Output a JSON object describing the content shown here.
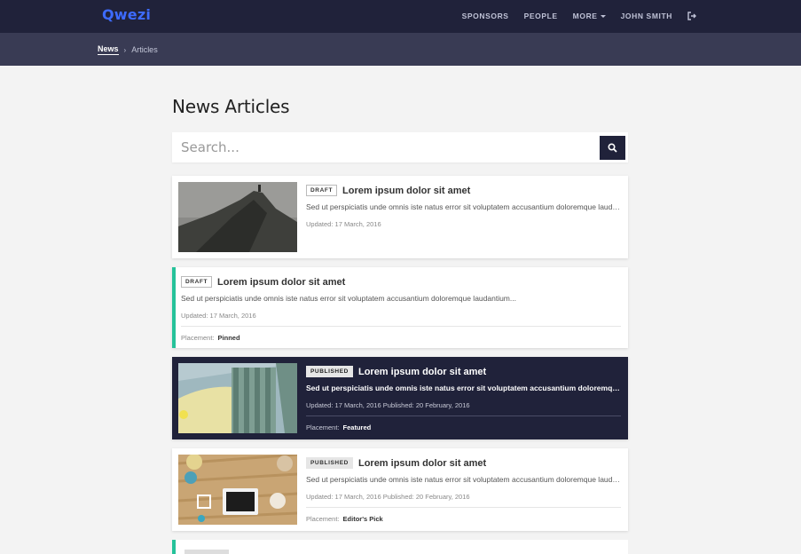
{
  "app": {
    "logo": "Qwezi"
  },
  "nav": {
    "items": [
      "SPONSORS",
      "PEOPLE",
      "MORE",
      "JOHN SMITH"
    ]
  },
  "breadcrumb": {
    "active": "News",
    "current": "Articles"
  },
  "page": {
    "title": "News Articles"
  },
  "search": {
    "placeholder": "Search..."
  },
  "articles": [
    {
      "status": "DRAFT",
      "title": "Lorem ipsum dolor sit amet",
      "description": "Sed ut perspiciatis unde omnis iste natus error sit voluptatem accusantium doloremque laudantium...",
      "meta": "Updated: 17 March, 2016",
      "placement_label": "",
      "placement": ""
    },
    {
      "status": "DRAFT",
      "title": "Lorem ipsum dolor sit amet",
      "description": "Sed ut perspiciatis unde omnis iste natus error sit voluptatem accusantium doloremque laudantium...",
      "meta": "Updated: 17 March, 2016",
      "placement_label": "Placement:",
      "placement": "Pinned"
    },
    {
      "status": "PUBLISHED",
      "title": "Lorem ipsum dolor sit amet",
      "description": "Sed ut perspiciatis unde omnis iste natus error sit voluptatem accusantium doloremque laudantium...",
      "meta": "Updated: 17 March, 2016 Published: 20 February, 2016",
      "placement_label": "Placement:",
      "placement": "Featured"
    },
    {
      "status": "PUBLISHED",
      "title": "Lorem ipsum dolor sit amet",
      "description": "Sed ut perspiciatis unde omnis iste natus error sit voluptatem accusantium doloremque laudantium...",
      "meta": "Updated: 17 March, 2016 Published: 20 February, 2016",
      "placement_label": "Placement:",
      "placement": "Editor's Pick"
    }
  ],
  "colors": {
    "navbar": "#20223a",
    "breadcrumb_bar": "#393b54",
    "accent": "#25c29a",
    "logo": "#3d6bff"
  }
}
